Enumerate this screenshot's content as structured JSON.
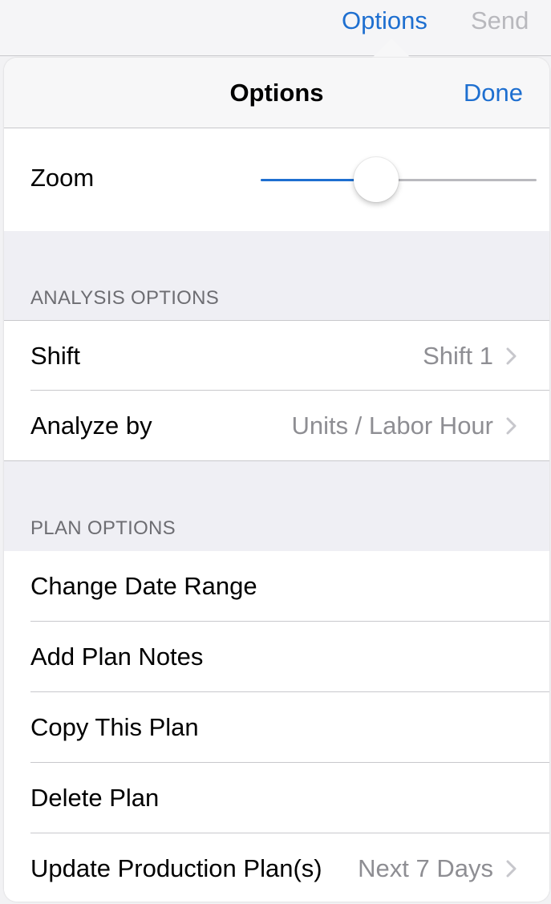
{
  "toolbar": {
    "options_label": "Options",
    "send_label": "Send"
  },
  "popover": {
    "title": "Options",
    "done_label": "Done",
    "zoom": {
      "label": "Zoom",
      "value_fraction": 0.42
    },
    "analysis_section": {
      "title": "ANALYSIS OPTIONS",
      "rows": [
        {
          "label": "Shift",
          "value": "Shift 1"
        },
        {
          "label": "Analyze by",
          "value": "Units / Labor Hour"
        }
      ]
    },
    "plan_section": {
      "title": "PLAN OPTIONS",
      "rows": [
        {
          "label": "Change Date Range"
        },
        {
          "label": "Add Plan Notes"
        },
        {
          "label": "Copy This Plan"
        },
        {
          "label": "Delete Plan"
        },
        {
          "label": "Update Production Plan(s)",
          "value": "Next 7 Days"
        }
      ]
    }
  },
  "colors": {
    "accent": "#1e6fd0",
    "disabled": "#b8b8bd",
    "secondary_text": "#8e8e93",
    "group_bg": "#efeff4"
  },
  "icons": {
    "disclosure": "chevron-right-icon"
  }
}
